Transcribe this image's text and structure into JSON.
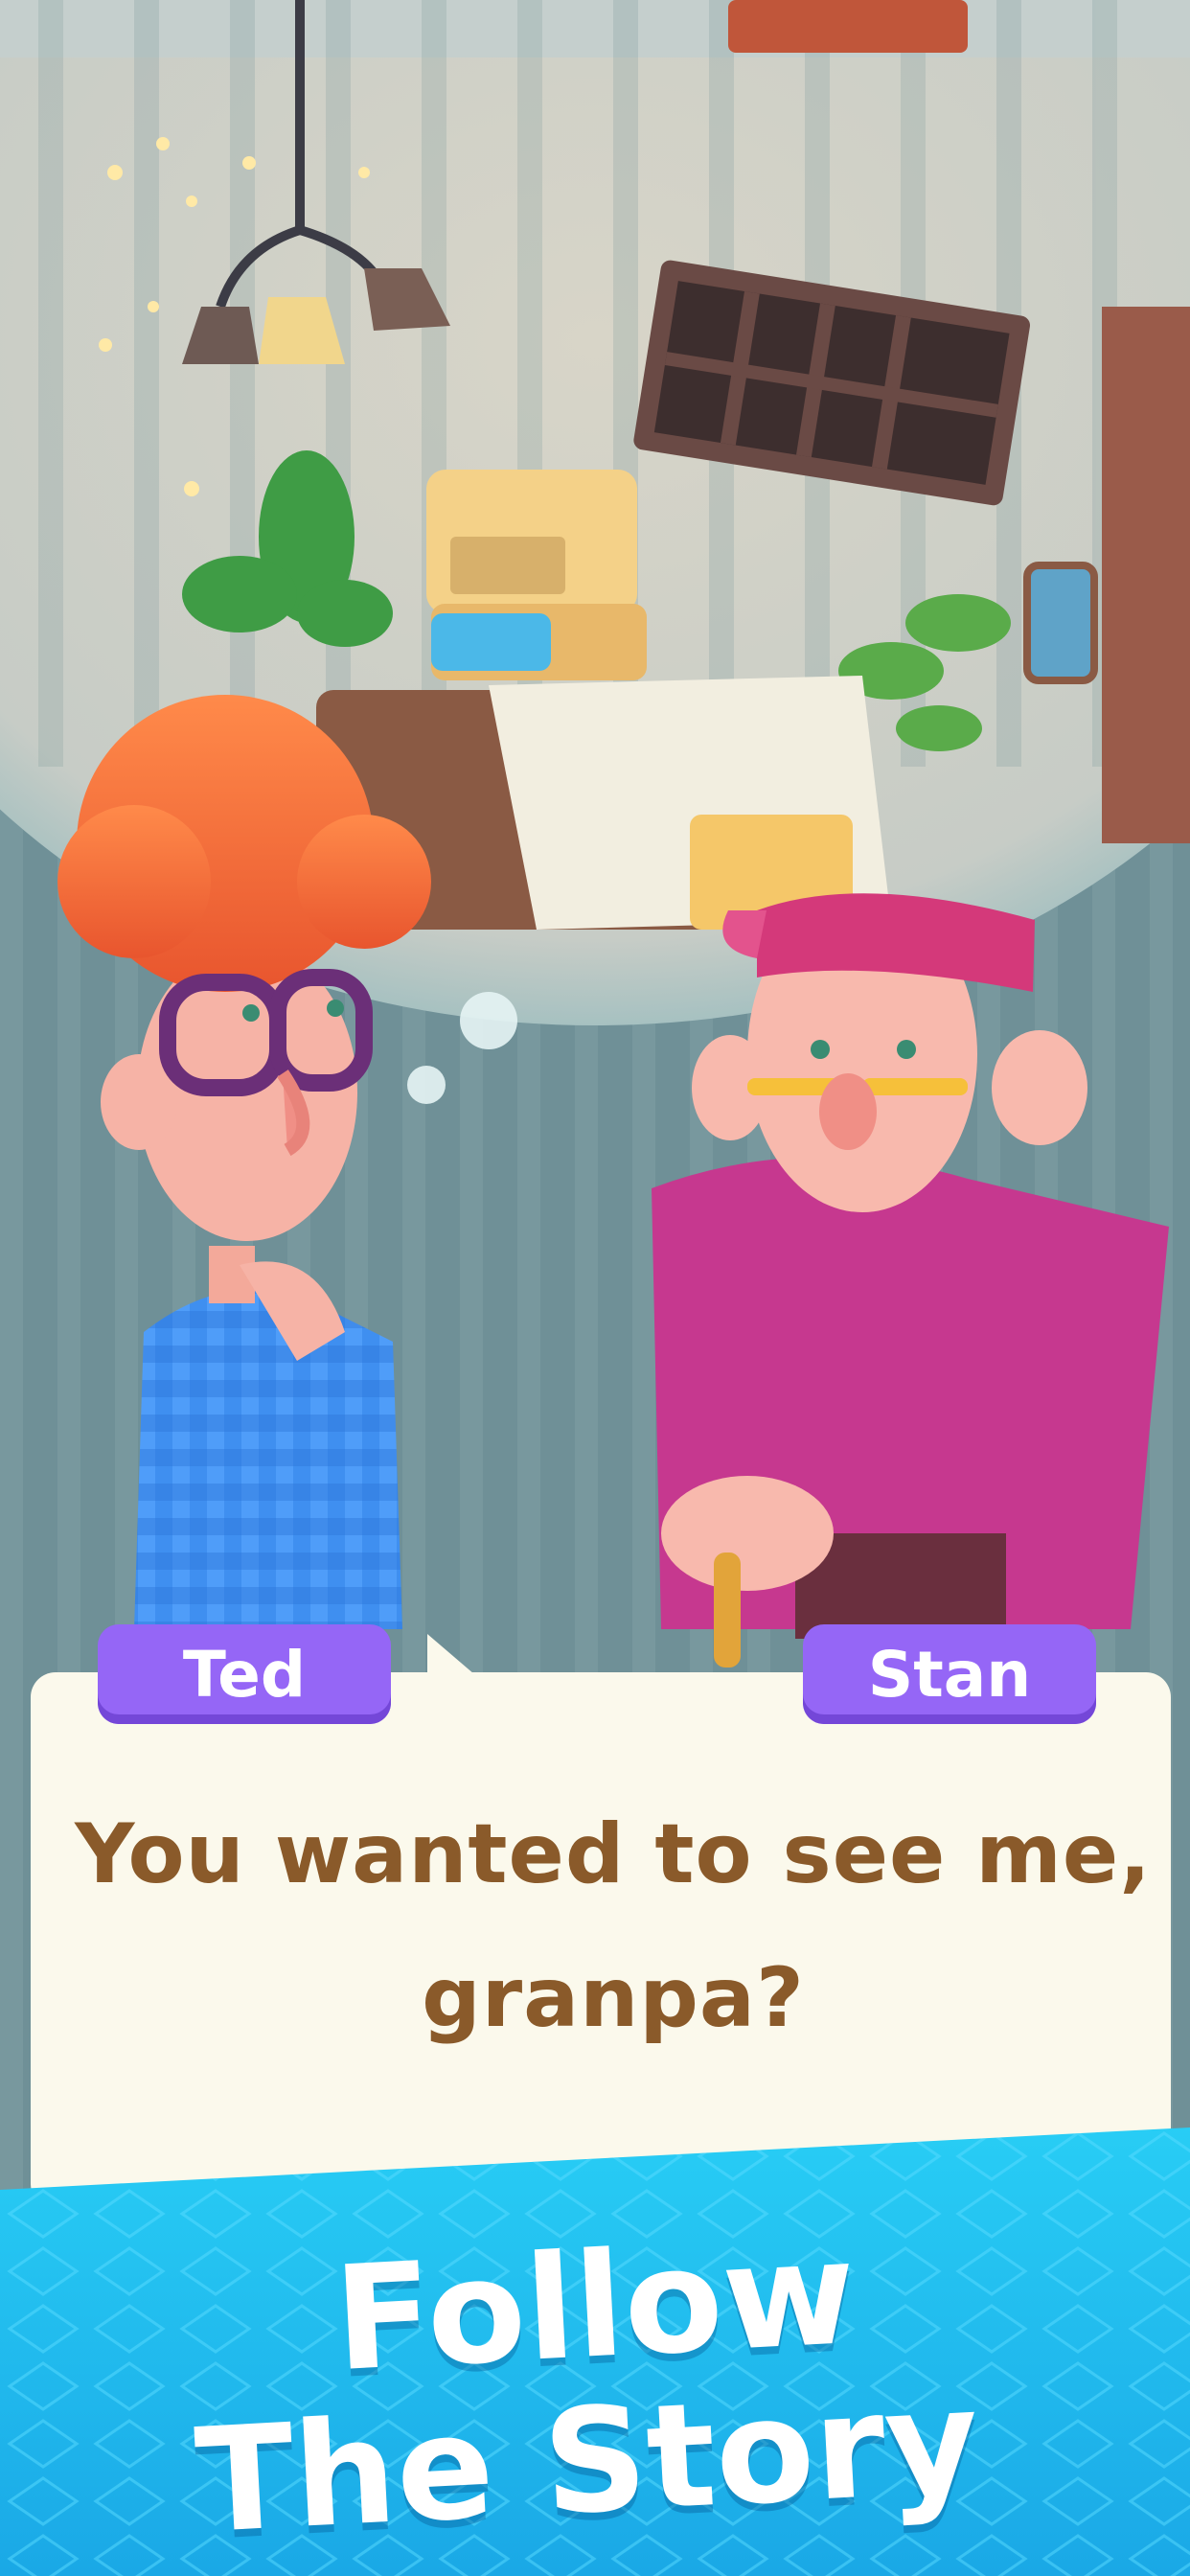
{
  "dialog": {
    "speakers": {
      "left": "Ted",
      "right": "Stan"
    },
    "text_line1": "You wanted to see me,",
    "text_line2": "granpa?"
  },
  "banner": {
    "line1": "Follow",
    "line2": "The Story",
    "color": "#1cc3f0"
  },
  "colors": {
    "name_tag": "#9566f6",
    "dialog_text": "#8a5a2a",
    "dialog_bg": "#fbf9ec"
  }
}
